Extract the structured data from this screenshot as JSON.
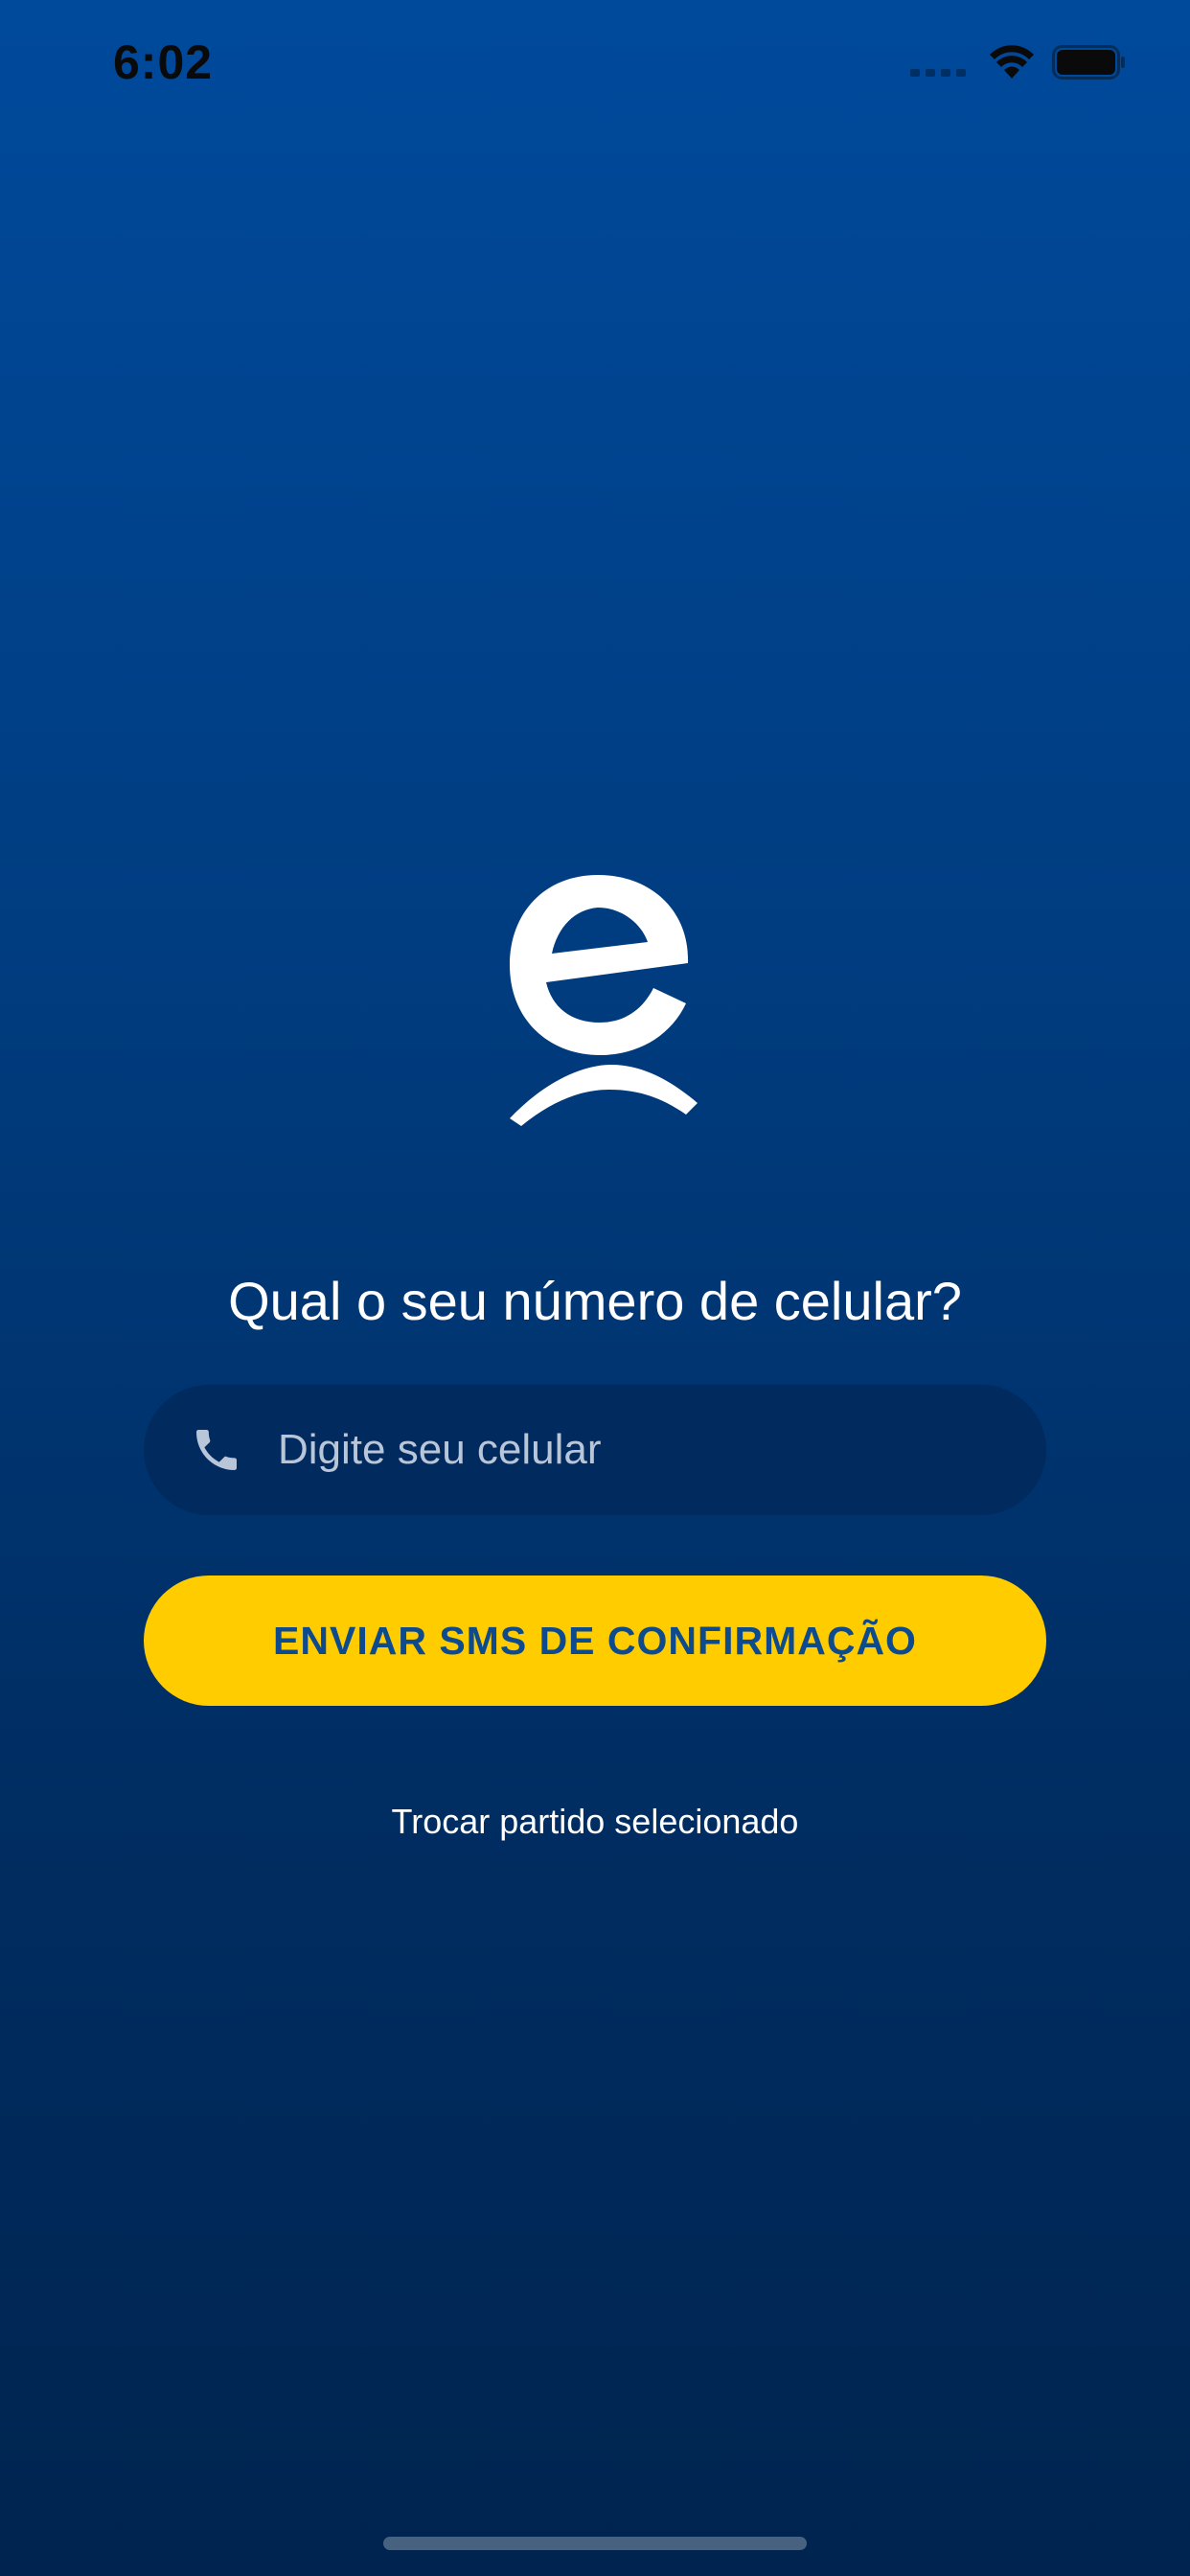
{
  "status_bar": {
    "time": "6:02",
    "icons": [
      "signal-icon",
      "wifi-icon",
      "battery-icon"
    ]
  },
  "logo": {
    "icon": "party-logo-icon",
    "color": "#FFFFFF"
  },
  "login": {
    "title": "Qual o seu número de celular?",
    "phone_placeholder": "Digite seu celular",
    "phone_value": "",
    "phone_icon": "phone-icon",
    "send_label": "ENVIAR SMS DE CONFIRMAÇÃO",
    "switch_label": "Trocar partido selecionado"
  },
  "colors": {
    "background_top": "#004A9C",
    "background_bottom": "#00244F",
    "accent": "#FFCC00",
    "button_text": "#0D4A8E",
    "input_background": "#012A5F"
  }
}
